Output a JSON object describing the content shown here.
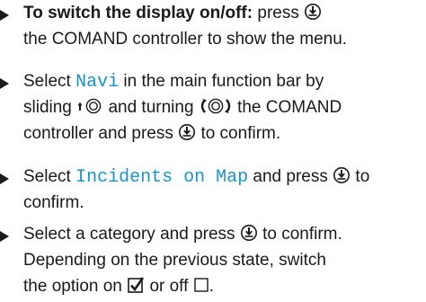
{
  "items": [
    {
      "l1_bold": "To switch the display on/off:",
      "l1_rest": " press",
      "l2": "the COMAND controller to show the menu."
    },
    {
      "l1": "Select",
      "menu_term": "Navi",
      "l1_rest": "in the main function bar by",
      "l2a": "sliding",
      "l2b": "and turning",
      "l2c": "the COMAND",
      "l3a": "controller and press",
      "l3b": "to confirm."
    },
    {
      "l1": "Select",
      "menu_term": "Incidents on Map",
      "l1_rest": "and press",
      "l1_end": "to",
      "l2": "confirm."
    },
    {
      "l1a": "Select a category and press",
      "l1b": "to confirm.",
      "l2": "Depending on the previous state, switch",
      "l3a": "the option on",
      "l3b": "or off",
      "l3c": "."
    }
  ],
  "icons": {
    "press": "press-controller-icon",
    "slide_up": "slide-up-controller-icon",
    "turn": "turn-controller-icon",
    "checked": "checkbox-checked-icon",
    "unchecked": "checkbox-unchecked-icon"
  },
  "colors": {
    "text": "#1a1a1a",
    "menu_term": "#1795c9"
  }
}
